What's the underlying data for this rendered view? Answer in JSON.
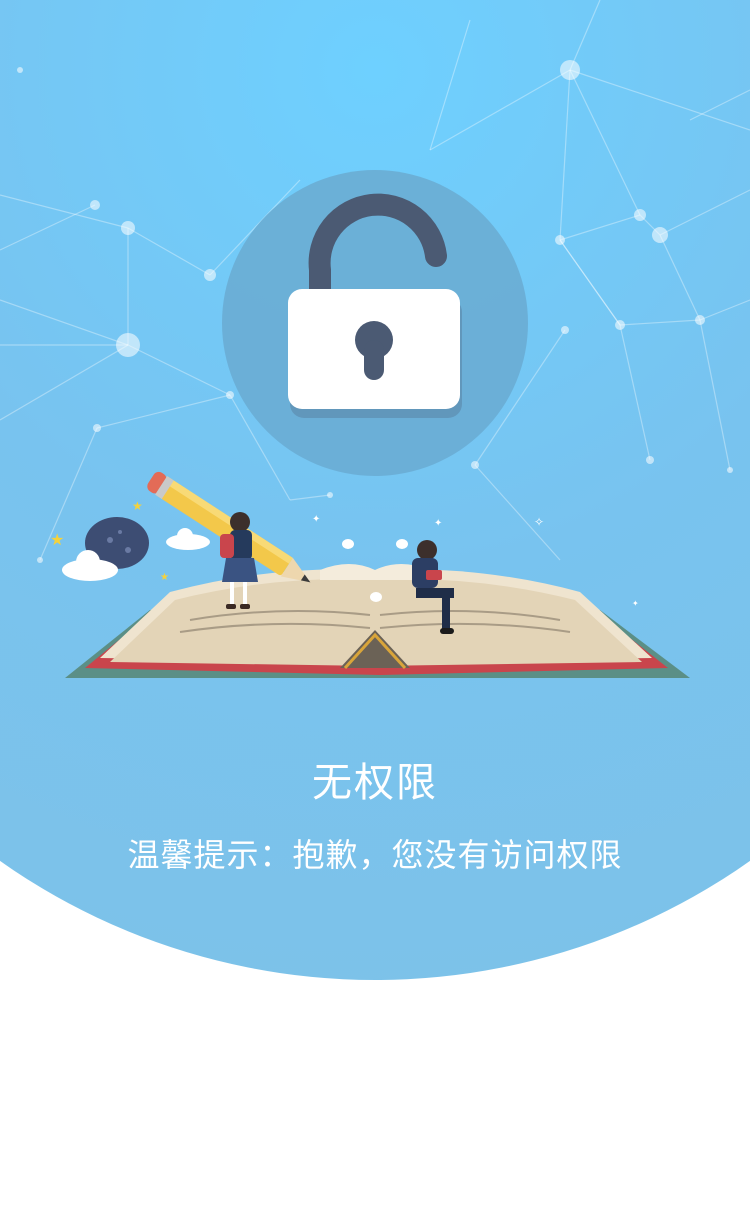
{
  "page": {
    "title": "无权限",
    "tip": "温馨提示：抱歉，您没有访问权限"
  },
  "icons": {
    "lock": "unlocked-padlock-icon",
    "illustration": "open-book-students-illustration"
  },
  "colors": {
    "hero_top": "#6ed0ff",
    "hero_bottom": "#7fc2e6",
    "lock_circle": "#6aaed5",
    "lock_body": "#ffffff",
    "lock_shackle": "#4b5a73"
  }
}
